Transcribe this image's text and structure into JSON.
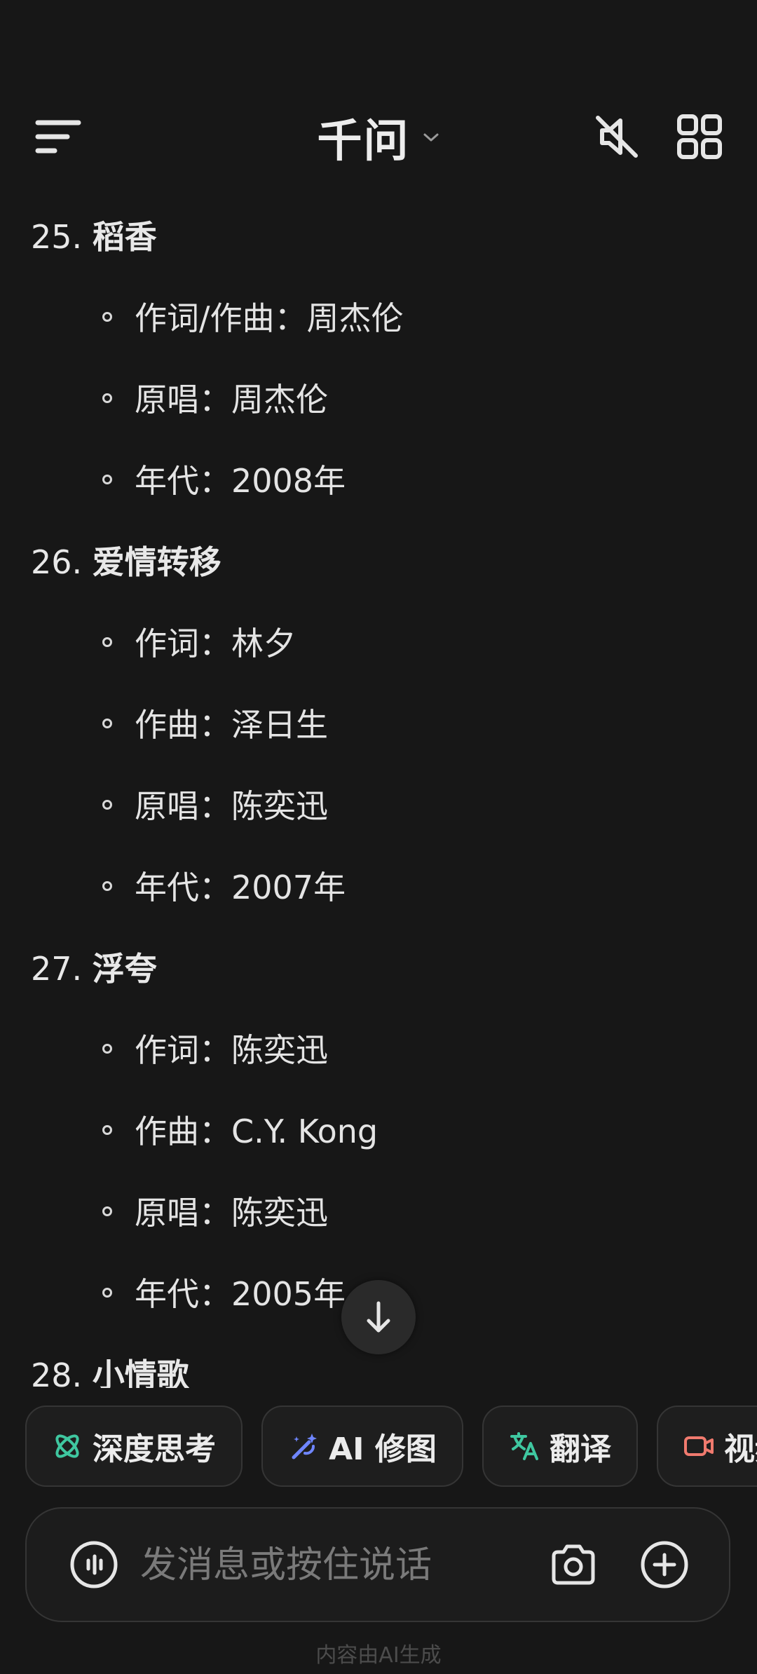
{
  "header": {
    "title": "千问"
  },
  "songs": [
    {
      "number": "25.",
      "name": "稻香",
      "details": [
        "作词/作曲：周杰伦",
        "原唱：周杰伦",
        "年代：2008年"
      ]
    },
    {
      "number": "26.",
      "name": "爱情转移",
      "details": [
        "作词：林夕",
        "作曲：泽日生",
        "原唱：陈奕迅",
        "年代：2007年"
      ]
    },
    {
      "number": "27.",
      "name": "浮夸",
      "details": [
        "作词：陈奕迅",
        "作曲：C.Y. Kong",
        "原唱：陈奕迅",
        "年代：2005年"
      ]
    },
    {
      "number": "28.",
      "name": "小情歌",
      "details": []
    }
  ],
  "chips": [
    {
      "label": "深度思考",
      "icon": "atom-icon",
      "color": "#3fc7a0"
    },
    {
      "label": "AI 修图",
      "icon": "magic-wand-icon",
      "color": "#6f86ff"
    },
    {
      "label": "翻译",
      "icon": "translate-icon",
      "color": "#3fc7a0"
    },
    {
      "label": "视频",
      "icon": "video-camera-icon",
      "color": "#f07a6e"
    }
  ],
  "input": {
    "placeholder": "发消息或按住说话"
  },
  "footer": {
    "note": "内容由AI生成"
  }
}
